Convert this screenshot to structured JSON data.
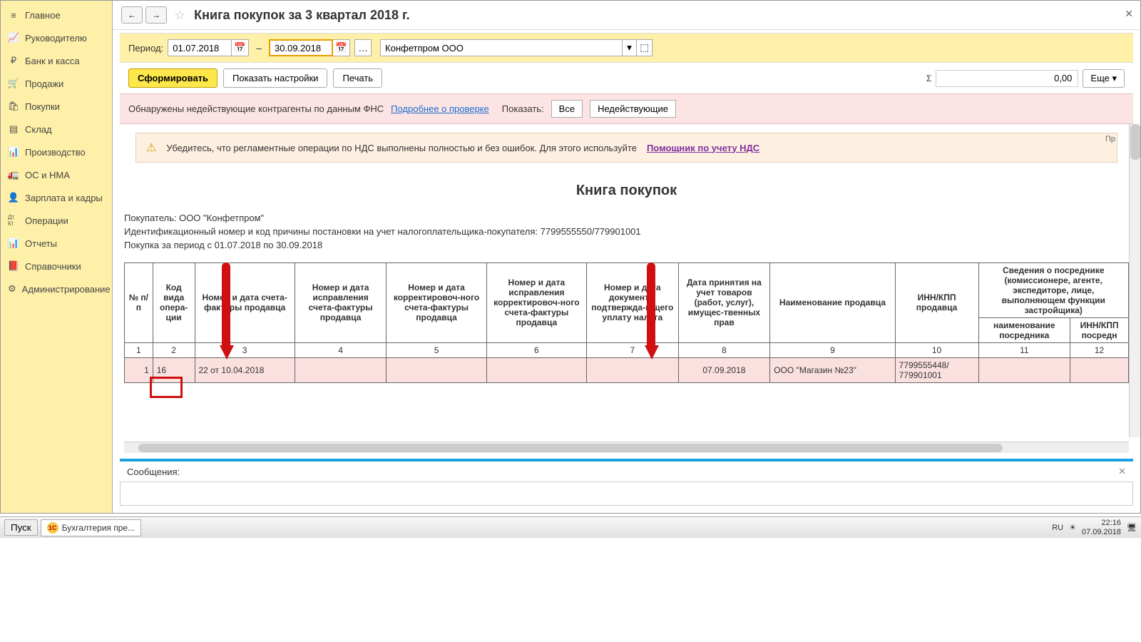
{
  "sidebar": {
    "items": [
      {
        "label": "Главное",
        "icon": "≡"
      },
      {
        "label": "Руководителю",
        "icon": "📈"
      },
      {
        "label": "Банк и касса",
        "icon": "₽"
      },
      {
        "label": "Продажи",
        "icon": "🛒"
      },
      {
        "label": "Покупки",
        "icon": "🛍"
      },
      {
        "label": "Склад",
        "icon": "▤"
      },
      {
        "label": "Производство",
        "icon": "📊"
      },
      {
        "label": "ОС и НМА",
        "icon": "🚛"
      },
      {
        "label": "Зарплата и кадры",
        "icon": "👤"
      },
      {
        "label": "Операции",
        "icon": "Дт Кт"
      },
      {
        "label": "Отчеты",
        "icon": "📊"
      },
      {
        "label": "Справочники",
        "icon": "📕"
      },
      {
        "label": "Администрирование",
        "icon": "⚙"
      }
    ]
  },
  "header": {
    "title": "Книга покупок за 3 квартал 2018 г."
  },
  "period": {
    "label": "Период:",
    "from": "01.07.2018",
    "to": "30.09.2018",
    "org": "Конфетпром ООО"
  },
  "actions": {
    "form": "Сформировать",
    "show_settings": "Показать настройки",
    "print": "Печать",
    "sum_symbol": "Σ",
    "sum_value": "0,00",
    "more": "Еще"
  },
  "alert": {
    "text": "Обнаружены недействующие контрагенты по данным ФНС",
    "link": "Подробнее о проверке",
    "show_label": "Показать:",
    "all": "Все",
    "inactive": "Недействующие"
  },
  "warn": {
    "text": "Убедитесь, что регламентные операции по НДС выполнены полностью и без ошибок. Для этого используйте",
    "link": "Помощник по учету НДС",
    "pr": "Пр"
  },
  "report": {
    "title": "Книга покупок",
    "buyer": "Покупатель:  ООО \"Конфетпром\"",
    "inn": "Идентификационный номер и код причины постановки на учет налогоплательщика-покупателя:  7799555550/779901001",
    "period_text": "Покупка за период с 01.07.2018 по 30.09.2018",
    "headers": {
      "c1": "№ п/п",
      "c2": "Код вида опера-ции",
      "c3": "Номер и дата счета-фактуры продавца",
      "c4": "Номер и дата исправления счета-фактуры продавца",
      "c5": "Номер и дата корректировоч-ного счета-фактуры продавца",
      "c6": "Номер и дата исправления корректировоч-ного счета-фактуры продавца",
      "c7": "Номер и дата документа, подтвержда-ющего уплату налога",
      "c8": "Дата принятия на учет товаров (работ, услуг), имущес-твенных прав",
      "c9": "Наименование продавца",
      "c10": "ИНН/КПП продавца",
      "c11_top": "Сведения о посреднике (комиссионере, агенте, экспедиторе, лице, выполняющем функции застройщика)",
      "c11": "наименование посредника",
      "c12": "ИНН/КПП посредн"
    },
    "nums": [
      "1",
      "2",
      "3",
      "4",
      "5",
      "6",
      "7",
      "8",
      "9",
      "10",
      "11",
      "12"
    ],
    "row": {
      "n": "1",
      "code": "16",
      "invoice": "22 от 10.04.2018",
      "c4": "",
      "c5": "",
      "c6": "",
      "c7": "",
      "date": "07.09.2018",
      "seller": "ООО \"Магазин №23\"",
      "inn": "7799555448/ 779901001",
      "c11": "",
      "c12": ""
    }
  },
  "messages": {
    "label": "Сообщения:"
  },
  "taskbar": {
    "start": "Пуск",
    "app": "Бухгалтерия пре...",
    "lang": "RU",
    "time": "22:16",
    "date": "07.09.2018"
  }
}
